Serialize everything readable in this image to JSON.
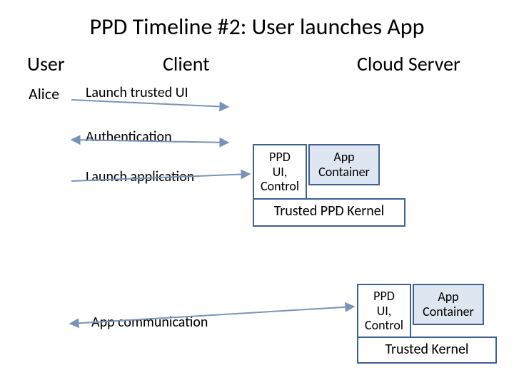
{
  "title": "PPD Timeline  #2:  User launches App",
  "columns": {
    "user": "User",
    "client": "Client",
    "cloud": "Cloud Server"
  },
  "actor": "Alice",
  "steps": {
    "launch_ui": "Launch trusted UI",
    "auth": "Authentication",
    "launch_app": "Launch application",
    "comm": "App communication"
  },
  "boxes": {
    "ppd_ui_ctrl": "PPD\nUI,\nControl",
    "app_container": "App\nContainer",
    "trusted_ppd_kernel": "Trusted PPD Kernel",
    "trusted_kernel": "Trusted  Kernel"
  },
  "colors": {
    "boxBorder": "#406090",
    "shadeFill": "#DDE6F1",
    "arrow": "#7893B8"
  }
}
